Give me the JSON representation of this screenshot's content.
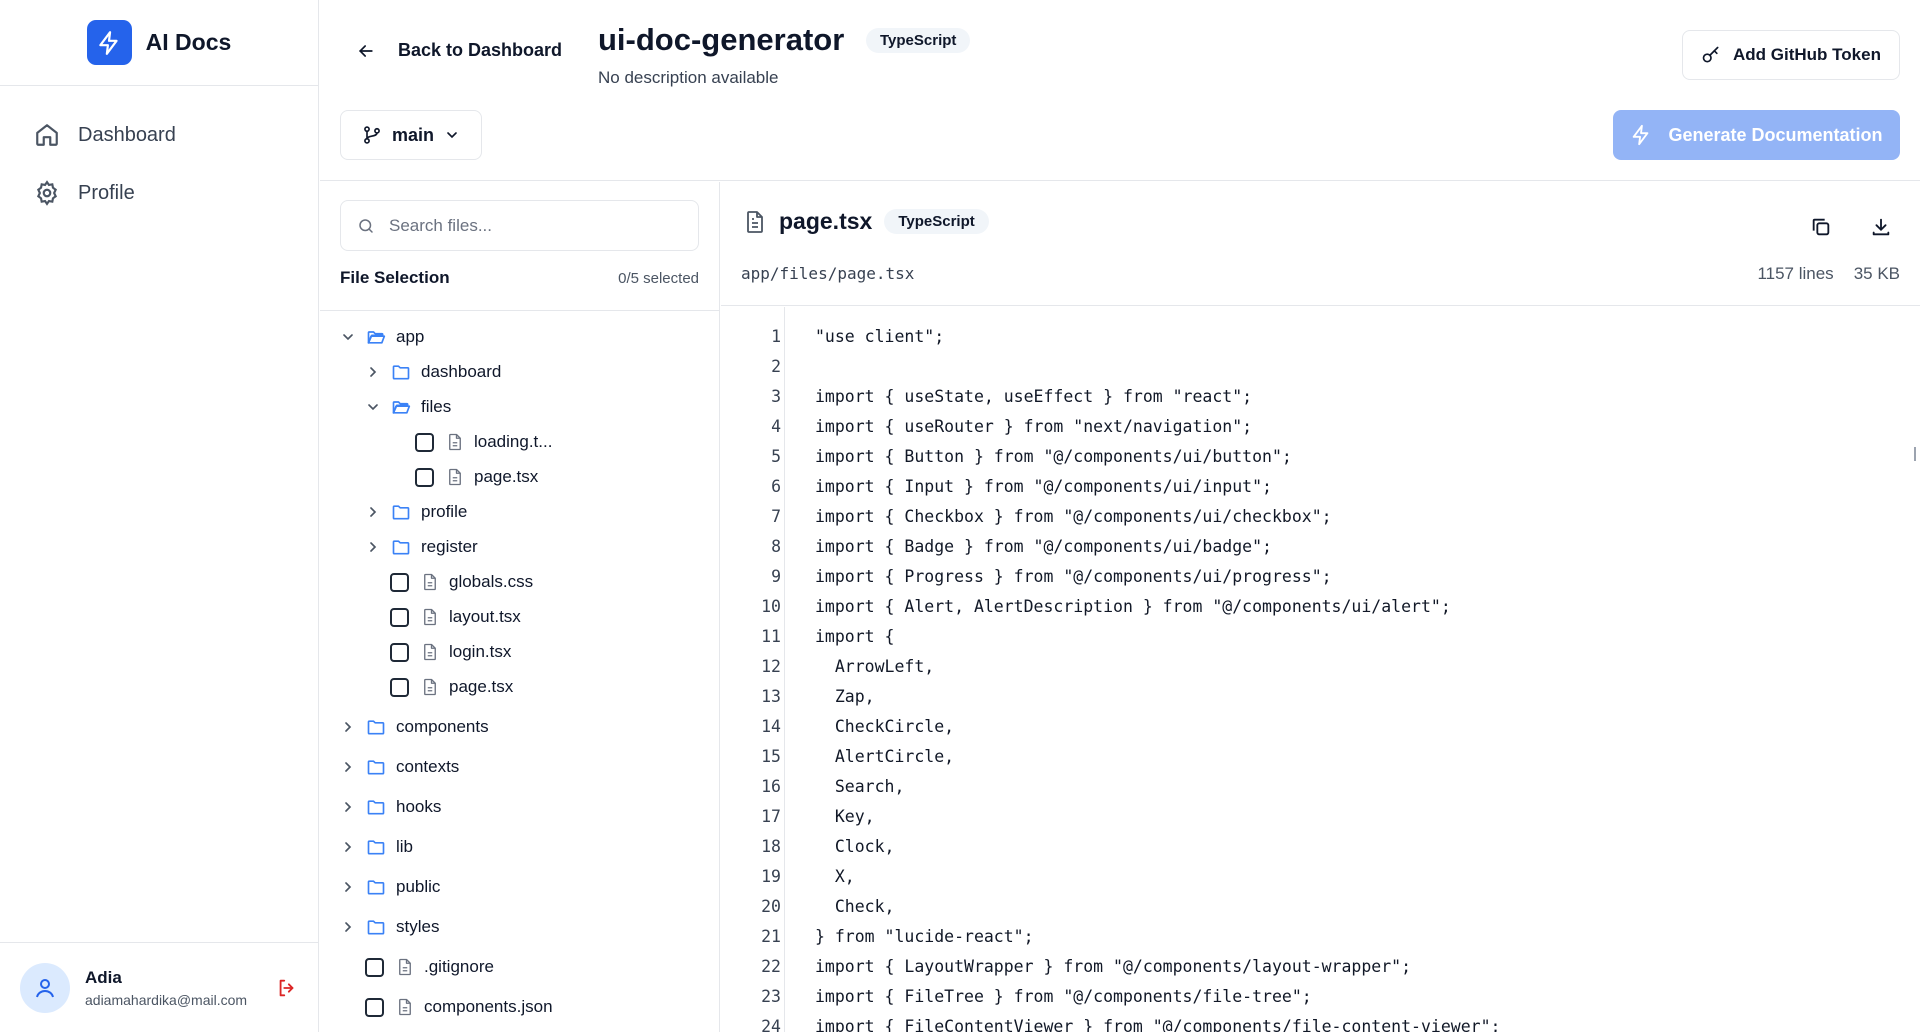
{
  "app": {
    "name": "AI Docs"
  },
  "sidebar": {
    "items": [
      {
        "label": "Dashboard",
        "icon": "home-icon"
      },
      {
        "label": "Profile",
        "icon": "gear-icon"
      }
    ],
    "user": {
      "name": "Adia",
      "email": "adiamahardika@mail.com"
    }
  },
  "header": {
    "back_label": "Back to Dashboard",
    "repo_name": "ui-doc-generator",
    "language": "TypeScript",
    "description": "No description available",
    "token_label": "Add GitHub Token",
    "branch": "main",
    "generate_label": "Generate Documentation"
  },
  "files": {
    "search_placeholder": "Search files...",
    "selection_title": "File Selection",
    "selection_count": "0/5 selected",
    "tree": [
      {
        "type": "folder",
        "name": "app",
        "depth": 0,
        "open": true
      },
      {
        "type": "folder",
        "name": "dashboard",
        "depth": 1,
        "open": false
      },
      {
        "type": "folder",
        "name": "files",
        "depth": 1,
        "open": true
      },
      {
        "type": "file",
        "name": "loading.t...",
        "depth": 2
      },
      {
        "type": "file",
        "name": "page.tsx",
        "depth": 2
      },
      {
        "type": "folder",
        "name": "profile",
        "depth": 1,
        "open": false
      },
      {
        "type": "folder",
        "name": "register",
        "depth": 1,
        "open": false
      },
      {
        "type": "file",
        "name": "globals.css",
        "depth": 1
      },
      {
        "type": "file",
        "name": "layout.tsx",
        "depth": 1
      },
      {
        "type": "file",
        "name": "login.tsx",
        "depth": 1
      },
      {
        "type": "file",
        "name": "page.tsx",
        "depth": 1
      },
      {
        "type": "folder",
        "name": "components",
        "depth": 0,
        "open": false
      },
      {
        "type": "folder",
        "name": "contexts",
        "depth": 0,
        "open": false
      },
      {
        "type": "folder",
        "name": "hooks",
        "depth": 0,
        "open": false
      },
      {
        "type": "folder",
        "name": "lib",
        "depth": 0,
        "open": false
      },
      {
        "type": "folder",
        "name": "public",
        "depth": 0,
        "open": false
      },
      {
        "type": "folder",
        "name": "styles",
        "depth": 0,
        "open": false
      },
      {
        "type": "file",
        "name": ".gitignore",
        "depth": 0
      },
      {
        "type": "file",
        "name": "components.json",
        "depth": 0
      }
    ]
  },
  "viewer": {
    "file_name": "page.tsx",
    "language": "TypeScript",
    "path": "app/files/page.tsx",
    "lines": "1157 lines",
    "size": "35 KB",
    "code": [
      "\"use client\";",
      "",
      "import { useState, useEffect } from \"react\";",
      "import { useRouter } from \"next/navigation\";",
      "import { Button } from \"@/components/ui/button\";",
      "import { Input } from \"@/components/ui/input\";",
      "import { Checkbox } from \"@/components/ui/checkbox\";",
      "import { Badge } from \"@/components/ui/badge\";",
      "import { Progress } from \"@/components/ui/progress\";",
      "import { Alert, AlertDescription } from \"@/components/ui/alert\";",
      "import {",
      "  ArrowLeft,",
      "  Zap,",
      "  CheckCircle,",
      "  AlertCircle,",
      "  Search,",
      "  Key,",
      "  Clock,",
      "  X,",
      "  Check,",
      "} from \"lucide-react\";",
      "import { LayoutWrapper } from \"@/components/layout-wrapper\";",
      "import { FileTree } from \"@/components/file-tree\";",
      "import { FileContentViewer } from \"@/components/file-content-viewer\";"
    ]
  },
  "colors": {
    "accent": "#2563eb",
    "folder": "#3b82f6",
    "logout": "#dc2626",
    "generate_disabled": "#93b4f6"
  }
}
